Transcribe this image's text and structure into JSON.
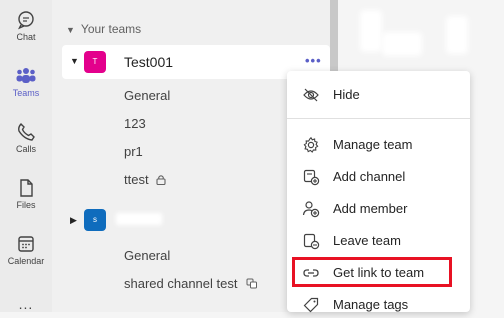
{
  "rail": {
    "items": [
      {
        "label": "Chat",
        "icon": "chat-icon"
      },
      {
        "label": "Teams",
        "icon": "teams-icon"
      },
      {
        "label": "Calls",
        "icon": "phone-icon"
      },
      {
        "label": "Files",
        "icon": "file-icon"
      },
      {
        "label": "Calendar",
        "icon": "calendar-icon"
      }
    ],
    "more": "...",
    "active_color": "#5b5fc7"
  },
  "teams": {
    "section_title": "Your teams",
    "team1": {
      "avatar_letter": "T",
      "avatar_color": "#e3008c",
      "name": "Test001",
      "more": "•••",
      "channels": [
        "General",
        "123",
        "pr1",
        "ttest"
      ]
    },
    "team2": {
      "avatar_letter": "s",
      "avatar_color": "#0f6cbd",
      "channels": [
        "General",
        "shared channel test"
      ]
    }
  },
  "menu": {
    "items": [
      {
        "label": "Hide",
        "icon": "hide-icon"
      },
      {
        "label": "Manage team",
        "icon": "gear-icon"
      },
      {
        "label": "Add channel",
        "icon": "add-channel-icon"
      },
      {
        "label": "Add member",
        "icon": "add-member-icon"
      },
      {
        "label": "Leave team",
        "icon": "leave-team-icon"
      },
      {
        "label": "Get link to team",
        "icon": "link-icon",
        "highlighted": true
      },
      {
        "label": "Manage tags",
        "icon": "tag-icon"
      }
    ],
    "highlight_color": "#e81123"
  }
}
